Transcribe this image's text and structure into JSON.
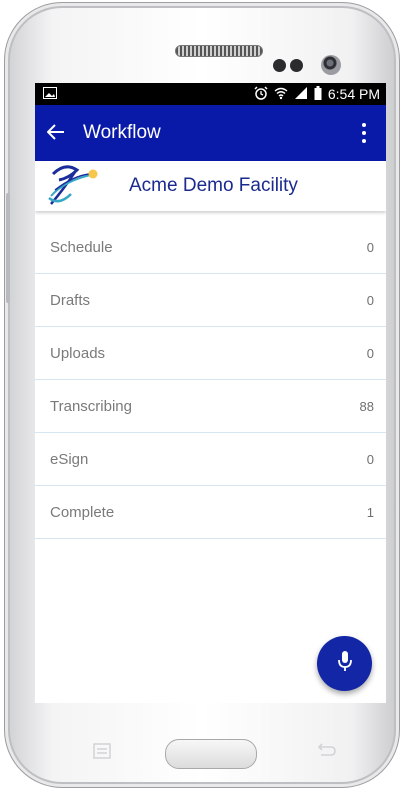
{
  "status_bar": {
    "time": "6:54 PM",
    "icons": [
      "image-icon",
      "alarm-icon",
      "wifi-icon",
      "signal-icon",
      "battery-icon"
    ]
  },
  "app_bar": {
    "title": "Workflow",
    "back_icon": "arrow-back-icon",
    "overflow_icon": "more-vert-icon",
    "color": "#0a1aa8"
  },
  "facility": {
    "name": "Acme Demo Facility",
    "logo": "acme-logo"
  },
  "workflow_items": [
    {
      "label": "Schedule",
      "count": "0"
    },
    {
      "label": "Drafts",
      "count": "0"
    },
    {
      "label": "Uploads",
      "count": "0"
    },
    {
      "label": "Transcribing",
      "count": "88"
    },
    {
      "label": "eSign",
      "count": "0"
    },
    {
      "label": "Complete",
      "count": "1"
    }
  ],
  "fab": {
    "icon": "microphone-icon",
    "color": "#1226a6"
  }
}
